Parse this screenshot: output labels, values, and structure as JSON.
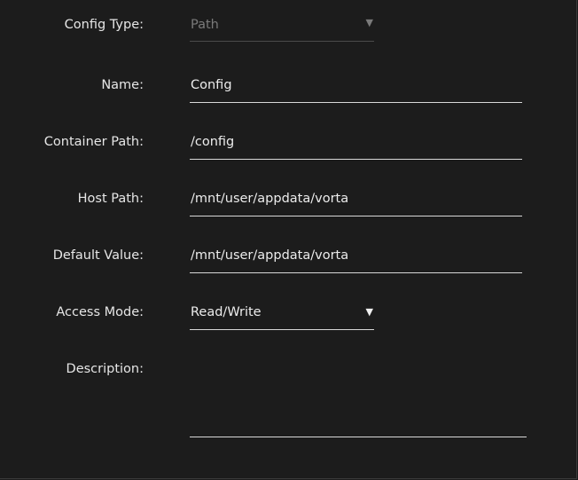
{
  "form": {
    "config_type": {
      "label": "Config Type:",
      "value": "Path"
    },
    "name": {
      "label": "Name:",
      "value": "Config"
    },
    "container_path": {
      "label": "Container Path:",
      "value": "/config"
    },
    "host_path": {
      "label": "Host Path:",
      "value": "/mnt/user/appdata/vorta"
    },
    "default_value": {
      "label": "Default Value:",
      "value": "/mnt/user/appdata/vorta"
    },
    "access_mode": {
      "label": "Access Mode:",
      "value": "Read/Write"
    },
    "description": {
      "label": "Description:",
      "value": ""
    }
  },
  "icons": {
    "dropdown": "▼"
  }
}
